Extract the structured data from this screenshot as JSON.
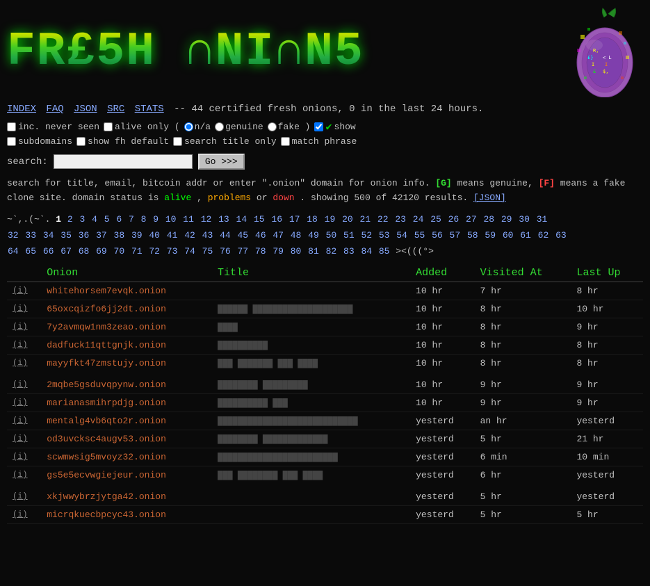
{
  "site": {
    "title": "FRESH ONIONS",
    "logo_line1": "FR£5H",
    "logo_line2": "ONIOMS"
  },
  "nav": {
    "items": [
      "INDEX",
      "FAQ",
      "JSON",
      "SRC",
      "STATS"
    ],
    "status_text": "-- 44 certified fresh onions, 0 in the last 24 hours."
  },
  "options": {
    "inc_never_seen_label": "inc. never seen",
    "alive_only_label": "alive only (",
    "na_label": "n/a",
    "genuine_label": "genuine",
    "fake_label": "fake )",
    "show_label": "show",
    "subdomains_label": "subdomains",
    "show_fh_label": "show fh default",
    "search_title_label": "search title only",
    "match_phrase_label": "match phrase"
  },
  "search": {
    "label": "search:",
    "placeholder": "",
    "button_label": "Go >>>"
  },
  "info": {
    "line1": "search for title, email, bitcoin addr or enter \".onion\" domain for onion info.",
    "genuine_badge": "[G]",
    "genuine_desc": "means genuine,",
    "fake_badge": "[F]",
    "fake_desc": "means a fake clone site. domain status is",
    "alive": "alive",
    "comma": ",",
    "problems": "problems",
    "or": "or",
    "down": "down",
    "period": ".",
    "showing": "showing 500 of 42120 results.",
    "json_link": "[JSON]"
  },
  "pagination": {
    "prefix": "~`,.(~`.",
    "current": "1",
    "pages": [
      "2",
      "3",
      "4",
      "5",
      "6",
      "7",
      "8",
      "9",
      "10",
      "11",
      "12",
      "13",
      "14",
      "15",
      "16",
      "17",
      "18",
      "19",
      "20",
      "21",
      "22",
      "23",
      "24",
      "25",
      "26",
      "27",
      "28",
      "29",
      "30",
      "31",
      "32",
      "33",
      "34",
      "35",
      "36",
      "37",
      "38",
      "39",
      "40",
      "41",
      "42",
      "43",
      "44",
      "45",
      "46",
      "47",
      "48",
      "49",
      "50",
      "51",
      "52",
      "53",
      "54",
      "55",
      "56",
      "57",
      "58",
      "59",
      "60",
      "61",
      "62",
      "63",
      "64",
      "65",
      "66",
      "67",
      "68",
      "69",
      "70",
      "71",
      "72",
      "73",
      "74",
      "75",
      "76",
      "77",
      "78",
      "79",
      "80",
      "81",
      "82",
      "83",
      "84",
      "85"
    ],
    "suffix": "><(((°>"
  },
  "table": {
    "headers": [
      "",
      "Onion",
      "Title",
      "Added",
      "Visited At",
      "Last Up"
    ],
    "rows": [
      {
        "i": "(i)",
        "onion": "whitehorsem7evqk.onion",
        "title": "",
        "added": "10 hr",
        "visited": "7 hr",
        "last_up": "8 hr",
        "gap": false
      },
      {
        "i": "(i)",
        "onion": "65oxcqizfo6jj2dt.onion",
        "title": "blurred1",
        "added": "10 hr",
        "visited": "8 hr",
        "last_up": "10 hr",
        "gap": false
      },
      {
        "i": "(i)",
        "onion": "7y2avmqw1nm3zeao.onion",
        "title": "blurred2",
        "added": "10 hr",
        "visited": "8 hr",
        "last_up": "9 hr",
        "gap": false
      },
      {
        "i": "(i)",
        "onion": "dadfuck11qttgnjk.onion",
        "title": "blurred3",
        "added": "10 hr",
        "visited": "8 hr",
        "last_up": "8 hr",
        "gap": false
      },
      {
        "i": "(i)",
        "onion": "mayyfkt47zmstujy.onion",
        "title": "blurred4",
        "added": "10 hr",
        "visited": "8 hr",
        "last_up": "8 hr",
        "gap": false
      },
      {
        "i": "(i)",
        "onion": "2mqbe5gsduvqpynw.onion",
        "title": "blurred5",
        "added": "10 hr",
        "visited": "9 hr",
        "last_up": "9 hr",
        "gap": true
      },
      {
        "i": "(i)",
        "onion": "marianasmihrpdjg.onion",
        "title": "blurred6",
        "added": "10 hr",
        "visited": "9 hr",
        "last_up": "9 hr",
        "gap": false
      },
      {
        "i": "(i)",
        "onion": "mentalg4vb6qto2r.onion",
        "title": "blurred7",
        "added": "yesterd",
        "visited": "an hr",
        "last_up": "yesterd",
        "gap": false
      },
      {
        "i": "(i)",
        "onion": "od3uvcksc4augv53.onion",
        "title": "blurred8",
        "added": "yesterd",
        "visited": "5 hr",
        "last_up": "21 hr",
        "gap": false
      },
      {
        "i": "(i)",
        "onion": "scwmwsig5mvoyz32.onion",
        "title": "blurred9",
        "added": "yesterd",
        "visited": "6 min",
        "last_up": "10 min",
        "gap": false
      },
      {
        "i": "(i)",
        "onion": "gs5e5ecvwgiejeur.onion",
        "title": "blurred10",
        "added": "yesterd",
        "visited": "6 hr",
        "last_up": "yesterd",
        "gap": false
      },
      {
        "i": "(i)",
        "onion": "xkjwwybrzjytga42.onion",
        "title": "",
        "added": "yesterd",
        "visited": "5 hr",
        "last_up": "yesterd",
        "gap": true
      },
      {
        "i": "(i)",
        "onion": "micrqkuecbpcyc43.onion",
        "title": "",
        "added": "yesterd",
        "visited": "5 hr",
        "last_up": "5 hr",
        "gap": false
      }
    ]
  },
  "colors": {
    "bg": "#0a0a0a",
    "text": "#c0c0c0",
    "green": "#33dd33",
    "link_blue": "#88aaff",
    "onion_red": "#cc6633",
    "alive": "#00ff00",
    "problems": "#ffaa00",
    "down": "#ff4444"
  }
}
